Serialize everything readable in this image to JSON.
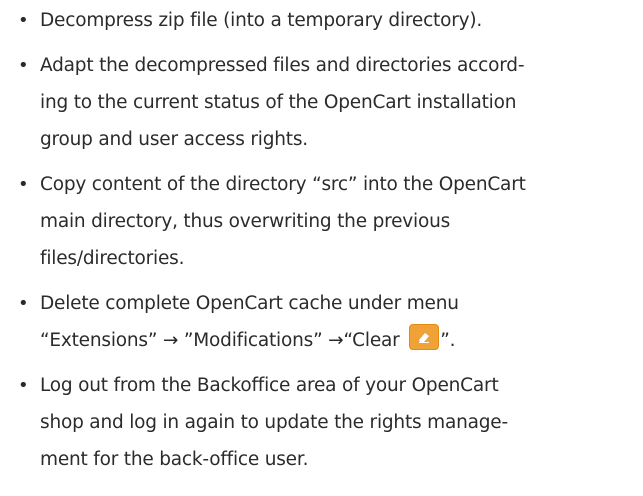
{
  "steps": [
    {
      "lines": [
        "Decompress zip file (into a temporary directory)."
      ]
    },
    {
      "lines": [
        "Adapt the decompressed files and directories accord-",
        "ing to the current status of the OpenCart installation",
        "group and user access rights."
      ]
    },
    {
      "lines": [
        "Copy content of the directory “src” into the OpenCart",
        "main directory, thus overwriting the previous",
        "files/directories."
      ]
    },
    {
      "line1": "Delete complete OpenCart cache under menu",
      "line2_prefix": "“Extensions” → ”Modifications” →“Clear ",
      "line2_suffix": "”.",
      "icon": "eraser-icon",
      "icon_color": "#f0a236"
    },
    {
      "lines": [
        "Log out from the Backoffice area of your OpenCart",
        "shop and log in again to update the rights manage-",
        "ment for the back-office user."
      ]
    }
  ],
  "bullet": "•"
}
